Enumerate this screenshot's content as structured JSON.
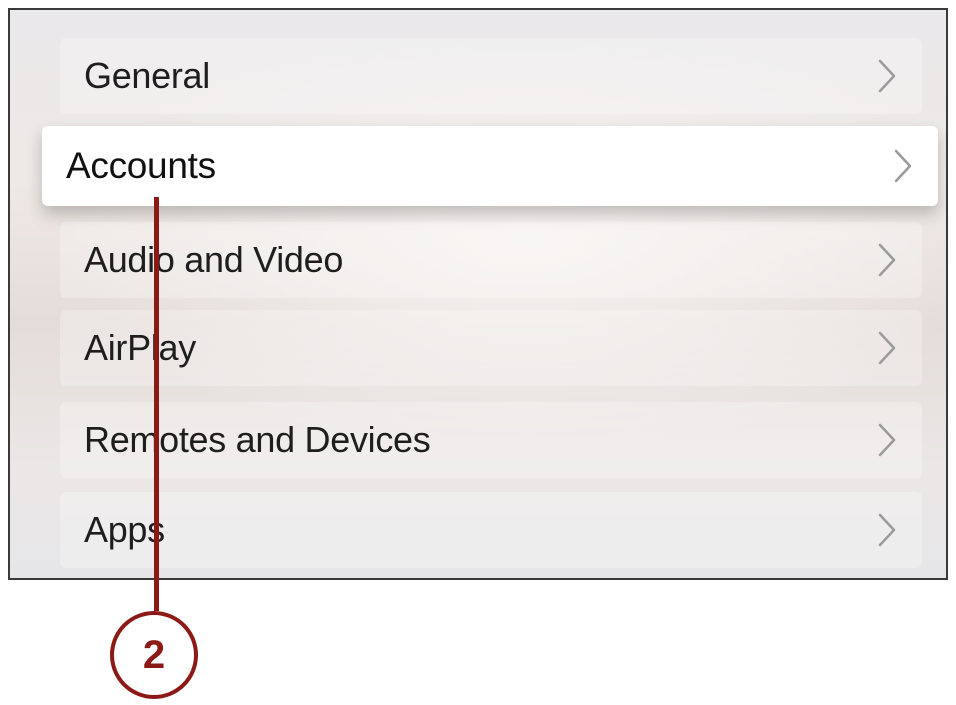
{
  "menu": {
    "items": [
      {
        "label": "General",
        "icon": "chevron-right-icon"
      },
      {
        "label": "Accounts",
        "icon": "chevron-right-icon",
        "focused": true
      },
      {
        "label": "Audio and Video",
        "icon": "chevron-right-icon"
      },
      {
        "label": "AirPlay",
        "icon": "chevron-right-icon"
      },
      {
        "label": "Remotes and Devices",
        "icon": "chevron-right-icon"
      },
      {
        "label": "Apps",
        "icon": "chevron-right-icon"
      }
    ]
  },
  "callout": {
    "number": "2",
    "color": "#8b1a17"
  },
  "colors": {
    "focused_row": "#ffffff",
    "text": "#1e1e1e",
    "chevron": "#9a9a9a"
  }
}
